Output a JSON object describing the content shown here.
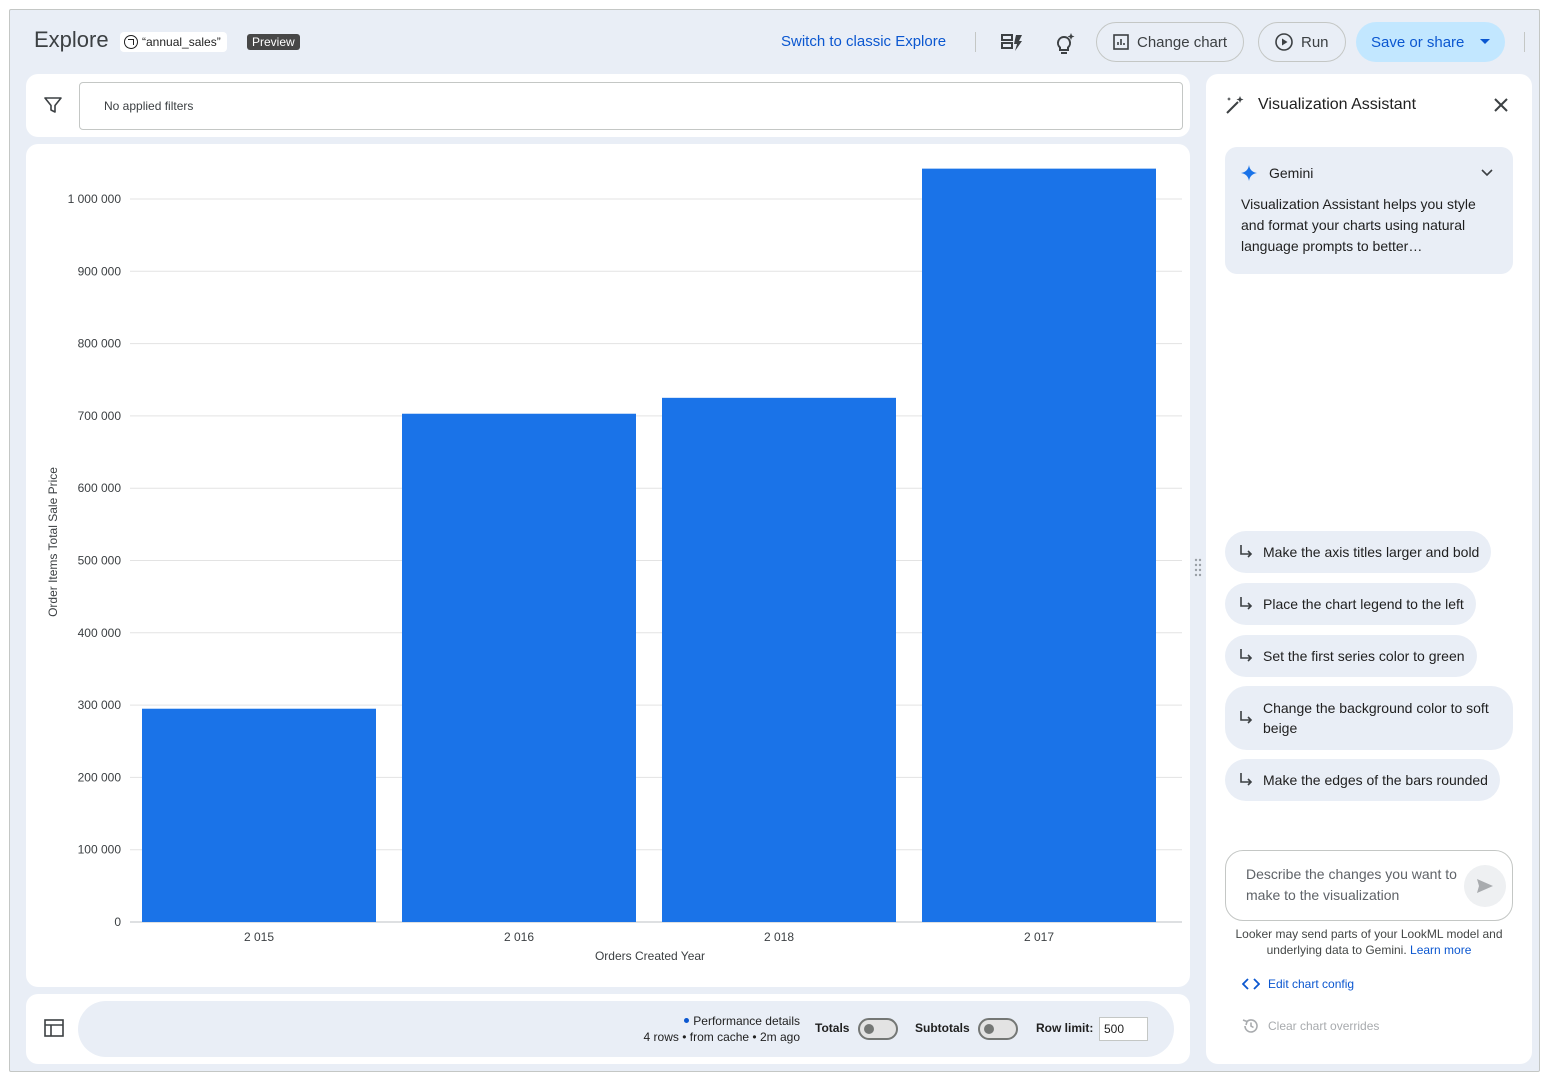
{
  "header": {
    "app_title": "Explore",
    "explore_name": "“annual_sales”",
    "preview_badge": "Preview",
    "switch_link": "Switch to classic Explore",
    "change_chart_label": "Change chart",
    "run_label": "Run",
    "save_share_label": "Save or share"
  },
  "filters": {
    "text": "No applied filters"
  },
  "chart_data": {
    "type": "bar",
    "categories": [
      "2 015",
      "2 016",
      "2 018",
      "2 017"
    ],
    "values": [
      295000,
      703000,
      725000,
      1042000
    ],
    "xlabel": "Orders Created Year",
    "ylabel": "Order Items Total Sale Price",
    "ylim": [
      0,
      1000000
    ],
    "yticks": [
      "0",
      "100 000",
      "200 000",
      "300 000",
      "400 000",
      "500 000",
      "600 000",
      "700 000",
      "800 000",
      "900 000",
      "1 000 000"
    ],
    "grid": true,
    "bar_color": "#1a73e8"
  },
  "footer": {
    "performance_link": "Performance details",
    "rows_info": "4 rows • from cache • 2m ago",
    "totals_label": "Totals",
    "subtotals_label": "Subtotals",
    "row_limit_label": "Row limit:",
    "row_limit_value": "500"
  },
  "assistant": {
    "title": "Visualization Assistant",
    "gemini_label": "Gemini",
    "gemini_text": "Visualization Assistant helps you style and format your charts using natural language prompts to better…",
    "suggestions": [
      "Make the axis titles larger and bold",
      "Place the chart legend to the left",
      "Set the first series color to green",
      "Change the background color to soft beige",
      "Make the edges of the bars rounded"
    ],
    "prompt_placeholder": "Describe the changes you want to make to the visualization",
    "disclaimer": "Looker may send parts of your LookML model and underlying data to Gemini.",
    "learn_more": "Learn more",
    "edit_config": "Edit chart config",
    "clear_overrides": "Clear chart overrides"
  },
  "colors": {
    "accent": "#0b57d0",
    "bar": "#1a73e8",
    "save_bg": "#c2e7ff",
    "app_bg": "#e9eef6"
  }
}
